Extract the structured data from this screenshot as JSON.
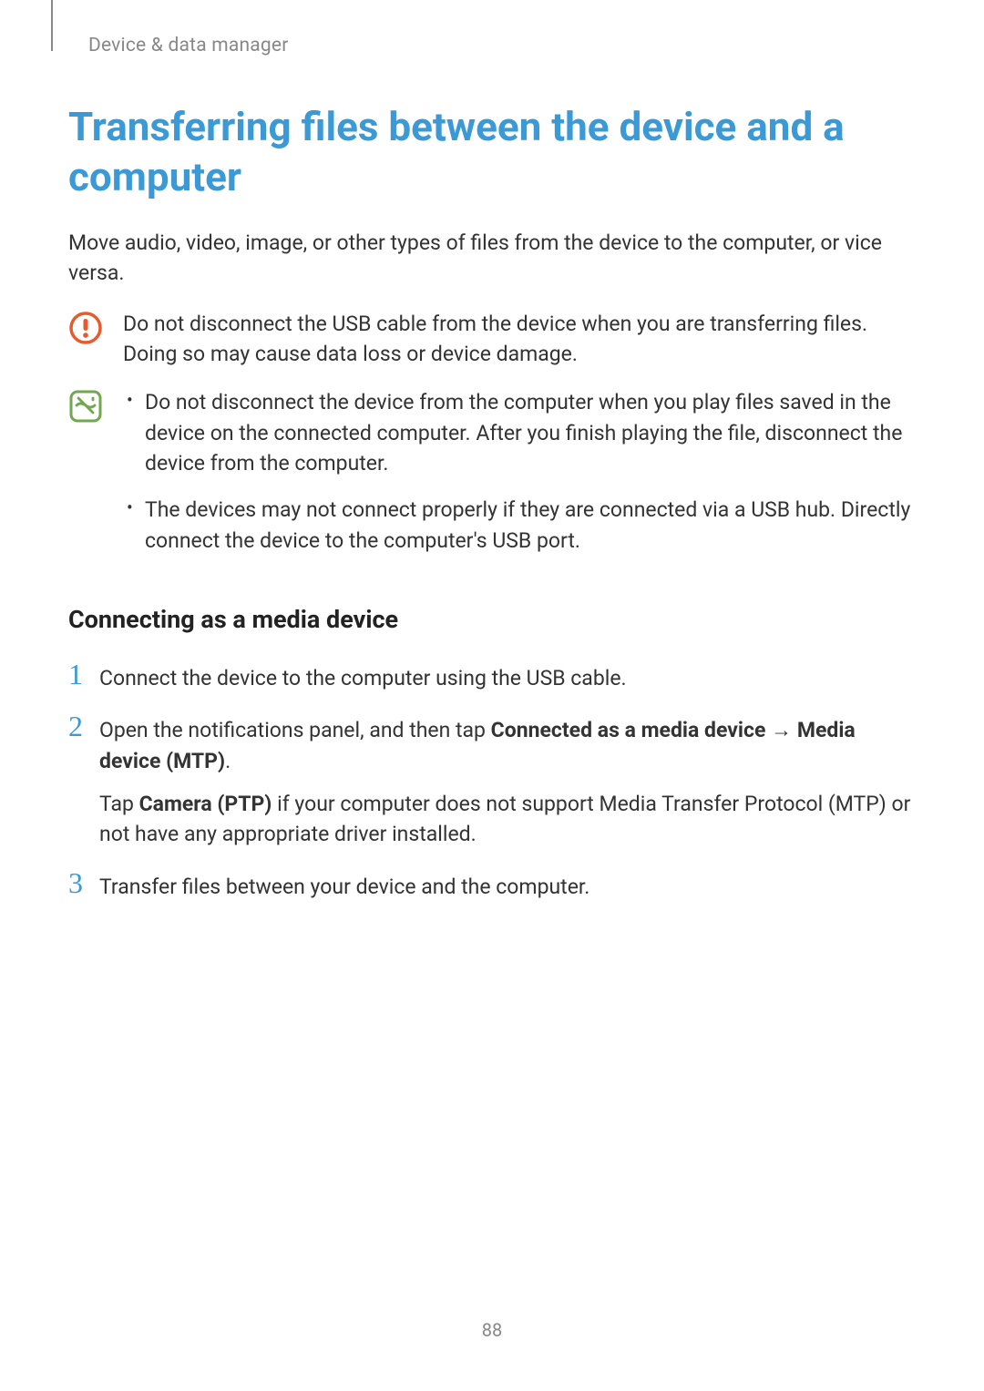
{
  "breadcrumb": "Device & data manager",
  "title": "Transferring files between the device and a computer",
  "intro": "Move audio, video, image, or other types of files from the device to the computer, or vice versa.",
  "caution_text": "Do not disconnect the USB cable from the device when you are transferring files. Doing so may cause data loss or device damage.",
  "note_items": [
    "Do not disconnect the device from the computer when you play files saved in the device on the connected computer. After you finish playing the file, disconnect the device from the computer.",
    "The devices may not connect properly if they are connected via a USB hub. Directly connect the device to the computer's USB port."
  ],
  "subheading": "Connecting as a media device",
  "steps": {
    "s1": {
      "num": "1",
      "text": "Connect the device to the computer using the USB cable."
    },
    "s2": {
      "num": "2",
      "p1_a": "Open the notifications panel, and then tap ",
      "p1_bold1": "Connected as a media device",
      "p1_arrow": " → ",
      "p1_bold2": "Media device (MTP)",
      "p1_end": ".",
      "p2_a": "Tap ",
      "p2_bold": "Camera (PTP)",
      "p2_b": " if your computer does not support Media Transfer Protocol (MTP) or not have any appropriate driver installed."
    },
    "s3": {
      "num": "3",
      "text": "Transfer files between your device and the computer."
    }
  },
  "page_number": "88"
}
